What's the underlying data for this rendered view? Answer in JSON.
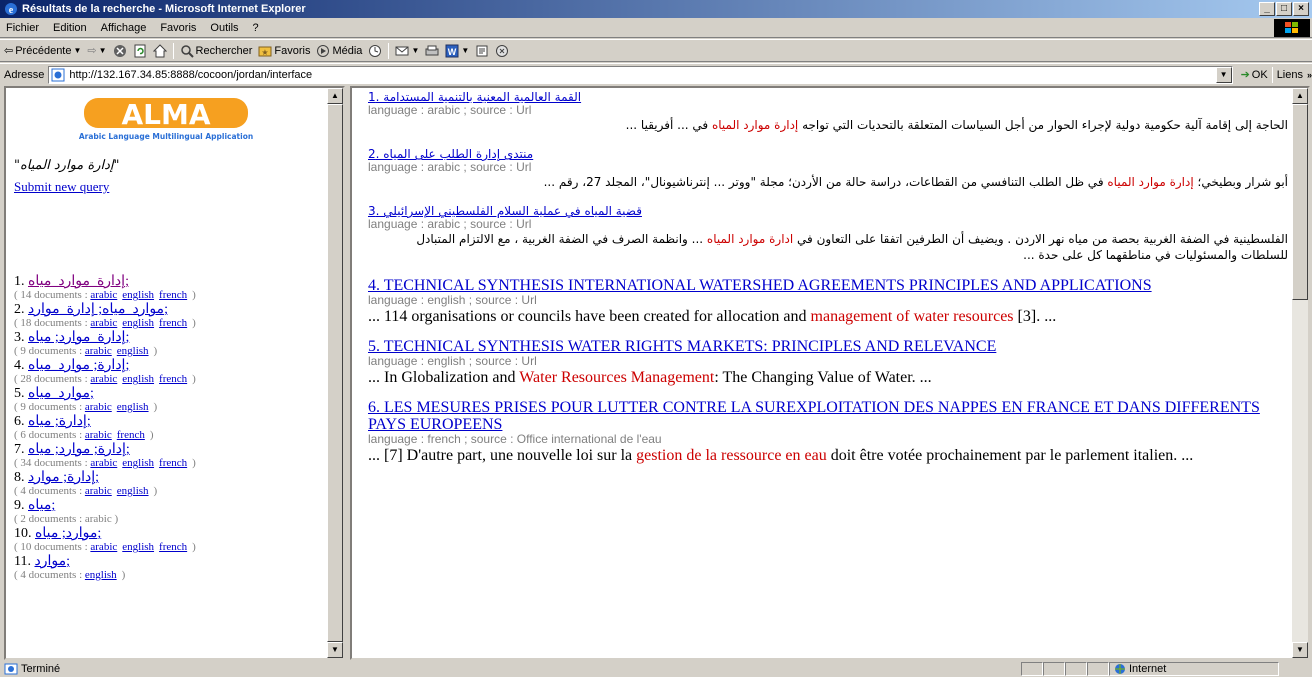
{
  "window": {
    "title": "Résultats de la recherche - Microsoft Internet Explorer"
  },
  "menu": [
    "Fichier",
    "Edition",
    "Affichage",
    "Favoris",
    "Outils",
    "?"
  ],
  "toolbar": {
    "back": "Précédente",
    "search": "Rechercher",
    "favorites": "Favoris",
    "media": "Média"
  },
  "address": {
    "label": "Adresse",
    "url": "http://132.167.34.85:8888/cocoon/jordan/interface",
    "go": "OK",
    "links": "Liens"
  },
  "left": {
    "logo_text": "ALMA",
    "logo_subtitle": "Arabic Language Multilingual Application",
    "query": "\"إدارة موارد المياه\"",
    "submit_label": "Submit new query",
    "queries": [
      {
        "num": "1.",
        "label": "إدارة_موارد_مياه;",
        "count": "( 14 documents :",
        "langs": [
          "arabic",
          "english",
          "french"
        ],
        "close": ")"
      },
      {
        "num": "2.",
        "label": "موارد_مياه; إدارة_موارد;",
        "count": "( 18 documents :",
        "langs": [
          "arabic",
          "english",
          "french"
        ],
        "close": ")"
      },
      {
        "num": "3.",
        "label": "إدارة_موارد; مياه;",
        "count": "( 9 documents :",
        "langs": [
          "arabic",
          "english"
        ],
        "close": ")"
      },
      {
        "num": "4.",
        "label": "إدارة; موارد_مياه;",
        "count": "( 28 documents :",
        "langs": [
          "arabic",
          "english",
          "french"
        ],
        "close": ")"
      },
      {
        "num": "5.",
        "label": "موارد_مياه;",
        "count": "( 9 documents :",
        "langs": [
          "arabic",
          "english"
        ],
        "close": ")"
      },
      {
        "num": "6.",
        "label": "إدارة; مياه;",
        "count": "( 6 documents :",
        "langs": [
          "arabic",
          "french"
        ],
        "close": ")"
      },
      {
        "num": "7.",
        "label": "إدارة; موارد; مياه;",
        "count": "( 34 documents :",
        "langs": [
          "arabic",
          "english",
          "french"
        ],
        "close": ")"
      },
      {
        "num": "8.",
        "label": "إدارة; موارد;",
        "count": "( 4 documents :",
        "langs": [
          "arabic",
          "english"
        ],
        "close": ")"
      },
      {
        "num": "9.",
        "label": "مياه;",
        "count": "( 2 documents : arabic",
        "langs": [],
        "close": ")"
      },
      {
        "num": "10.",
        "label": "موارد; مياه;",
        "count": "( 10 documents :",
        "langs": [
          "arabic",
          "english",
          "french"
        ],
        "close": ")"
      },
      {
        "num": "11.",
        "label": "موارد;",
        "count": "( 4 documents :",
        "langs": [
          "english"
        ],
        "close": ")"
      }
    ]
  },
  "results": [
    {
      "lang": "ar",
      "title": "القمة العالمية المعنية بالتنمية المستدامة .1",
      "meta": "language : arabic ; source : Url",
      "snippet_pre": "الحاجة إلى إقامة آلية حكومية دولية لإجراء الحوار من أجل السياسات المتعلقة بالتحديات التي تواجه ",
      "snippet_hl": "إدارة موارد المياه",
      "snippet_post": " في ... أفريقيا ..."
    },
    {
      "lang": "ar",
      "title": "منتدى إدارة الطلب على المياه .2",
      "meta": "language : arabic ; source : Url",
      "snippet_pre": "أبو شرار وبطيخي؛ ",
      "snippet_hl": "إدارة موارد المياه",
      "snippet_post": " في ظل الطلب التنافسي من القطاعات، دراسة حالة من الأردن؛ مجلة \"ووتر ... إنترناشيونال\"، المجلد 27، رقم ..."
    },
    {
      "lang": "ar",
      "title": "قضية المياه في عملية السلام الفلسطيني الإسرائيلي .3",
      "meta": "language : arabic ; source : Url",
      "snippet_pre": "الفلسطينية في الضفة الغربية بحصة من مياه نهر الاردن . ويضيف أن الطرفين اتفقا على التعاون في ",
      "snippet_hl": "ادارة موارد المياه",
      "snippet_post": " ... وانظمة الصرف في الضفة الغربية ، مع الالتزام المتبادل للسلطات والمسئوليات في مناطقهما كل على حدة ..."
    },
    {
      "lang": "en",
      "title": "4. TECHNICAL SYNTHESIS INTERNATIONAL WATERSHED AGREEMENTS PRINCIPLES AND APPLICATIONS",
      "meta": "language : english ; source : Url",
      "snippet_pre": "... 114 organisations or councils have been created for allocation and ",
      "snippet_hl": "management of water resources",
      "snippet_post": " [3]. ..."
    },
    {
      "lang": "en",
      "title": "5. TECHNICAL SYNTHESIS WATER RIGHTS MARKETS: PRINCIPLES AND RELEVANCE",
      "meta": "language : english ; source : Url",
      "snippet_pre": "... In Globalization and ",
      "snippet_hl": "Water Resources Management",
      "snippet_post": ": The Changing Value of Water. ..."
    },
    {
      "lang": "en",
      "title": "6. LES MESURES PRISES POUR LUTTER CONTRE LA SUREXPLOITATION DES NAPPES EN FRANCE ET DANS DIFFERENTS PAYS EUROPEENS",
      "meta": "language : french ; source : Office international de l'eau",
      "snippet_pre": "... [7] D'autre part, une nouvelle loi sur la ",
      "snippet_hl": "gestion de la ressource en eau",
      "snippet_post": " doit être votée prochainement par le parlement italien. ..."
    }
  ],
  "status": {
    "text": "Terminé",
    "zone": "Internet"
  },
  "colors": {
    "link": "#0000cc",
    "visited": "#800080",
    "highlight": "#cc0000",
    "titlebar": "#0a246a"
  }
}
